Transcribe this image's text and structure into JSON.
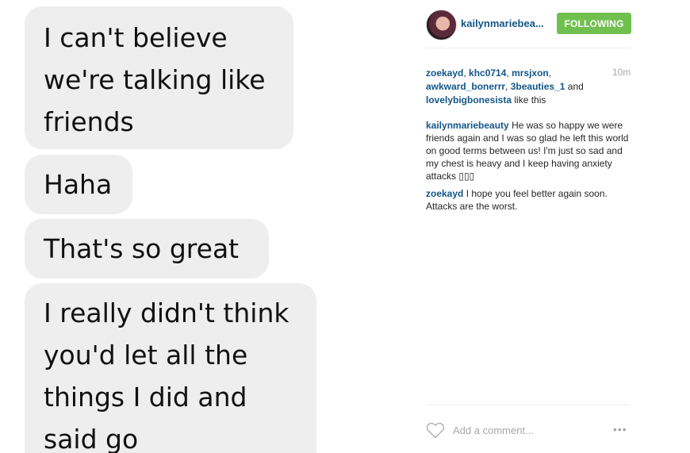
{
  "messages": [
    {
      "lines": [
        "I can't believe",
        "we're talking like",
        "friends"
      ]
    },
    {
      "lines": [
        "Haha"
      ]
    },
    {
      "lines": [
        "That's so great"
      ]
    },
    {
      "lines": [
        "I really didn't think",
        "you'd let all the",
        "things I did and",
        "said go"
      ]
    }
  ],
  "post": {
    "username": "kailynmariebea...",
    "follow_label": "FOLLOWING",
    "time": "10m",
    "likes": {
      "users": [
        "zoekayd",
        "khc0714",
        "mrsjxon",
        "awkward_bonerrr",
        "3beauties_1",
        "lovelybigbonesista"
      ],
      "and": "and",
      "suffix": "like this"
    },
    "comments": [
      {
        "author": "kailynmariebeauty",
        "text": "He was so happy we were friends again and I was so glad he left this world on good terms between us! I'm just so sad and my chest is heavy and I keep having anxiety attacks ▯▯▯"
      },
      {
        "author": "zoekayd",
        "text": "I hope you feel better again soon. Attacks are the worst."
      }
    ],
    "add_comment_placeholder": "Add a comment...",
    "more_label": "•••"
  },
  "colors": {
    "link": "#125688",
    "follow_bg": "#70c050",
    "muted": "#a5a7aa",
    "bubble": "#eeeeee"
  }
}
